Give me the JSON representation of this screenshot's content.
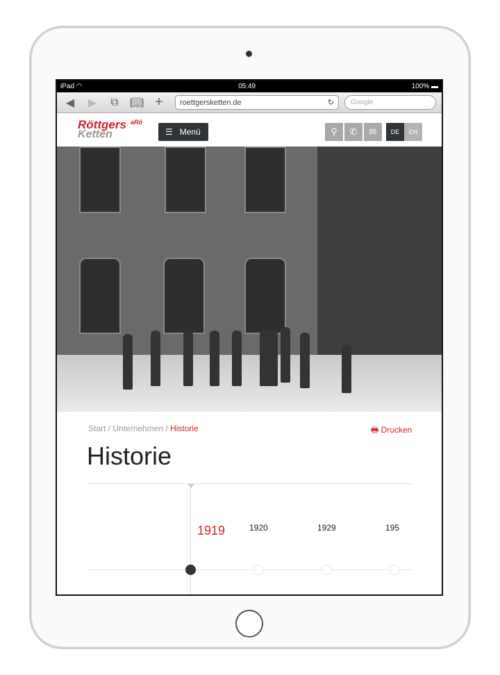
{
  "status_bar": {
    "device": "iPad",
    "time": "05:49",
    "battery": "100%"
  },
  "browser": {
    "url": "roettgersketten.de",
    "search_placeholder": "Google"
  },
  "site": {
    "logo_line1": "Röttgers",
    "logo_line2": "Ketten",
    "logo_mark": "aRö",
    "menu_label": "Menü",
    "languages": [
      {
        "label": "DE",
        "active": true
      },
      {
        "label": "EN",
        "active": false
      }
    ],
    "accent": "#d2232a"
  },
  "breadcrumb": [
    {
      "label": "Start"
    },
    {
      "label": "Unternehmen"
    },
    {
      "label": "Historie"
    }
  ],
  "print_label": "Drucken",
  "page_title": "Historie",
  "timeline": {
    "years": [
      {
        "label": "1919",
        "active": true
      },
      {
        "label": "1920",
        "active": false
      },
      {
        "label": "1929",
        "active": false
      },
      {
        "label": "195",
        "active": false
      }
    ]
  }
}
